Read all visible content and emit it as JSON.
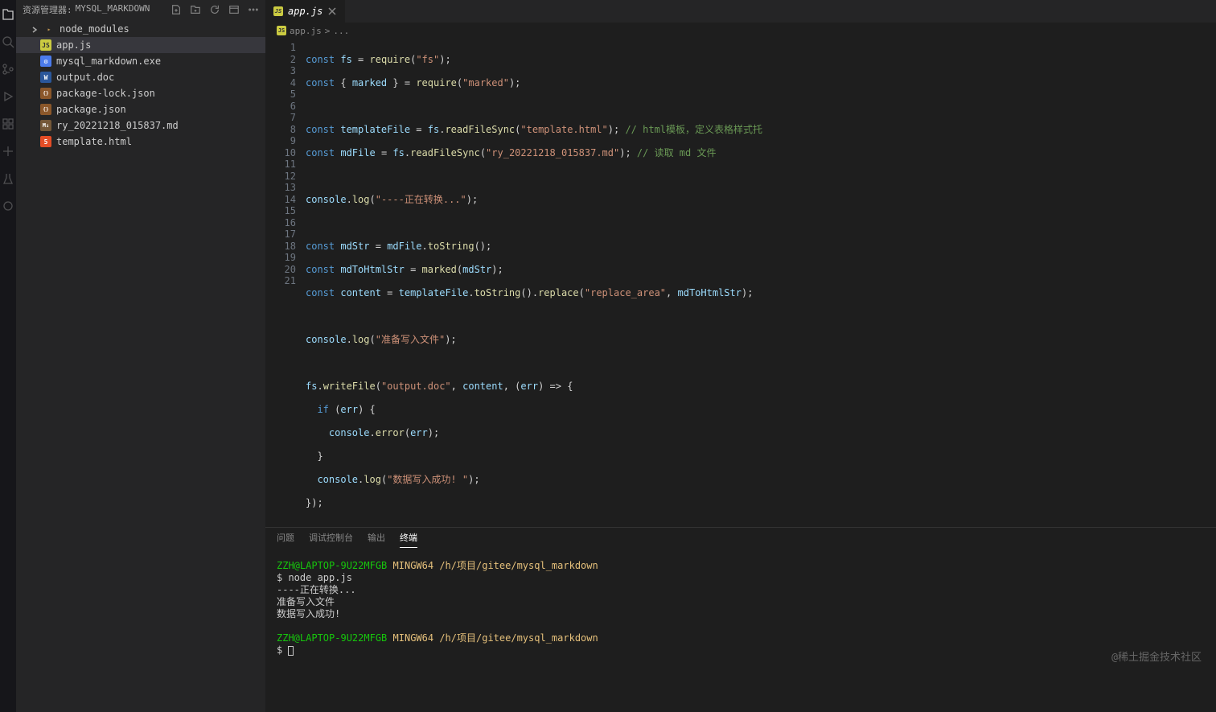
{
  "sidebar": {
    "title_label": "资源管理器:",
    "project": "MYSQL_MARKDOWN",
    "files": [
      {
        "name": "node_modules",
        "type": "folder"
      },
      {
        "name": "app.js",
        "type": "js",
        "active": true
      },
      {
        "name": "mysql_markdown.exe",
        "type": "exe"
      },
      {
        "name": "output.doc",
        "type": "doc"
      },
      {
        "name": "package-lock.json",
        "type": "json"
      },
      {
        "name": "package.json",
        "type": "json"
      },
      {
        "name": "ry_20221218_015837.md",
        "type": "md"
      },
      {
        "name": "template.html",
        "type": "html"
      }
    ]
  },
  "tab": {
    "name": "app.js"
  },
  "breadcrumb": {
    "file": "app.js",
    "sep": ">",
    "rest": "..."
  },
  "gutter_lines": [
    "1",
    "2",
    "3",
    "4",
    "5",
    "6",
    "7",
    "8",
    "9",
    "10",
    "11",
    "12",
    "13",
    "14",
    "15",
    "16",
    "17",
    "18",
    "19",
    "20",
    "21"
  ],
  "panel": {
    "tabs": [
      "问题",
      "调试控制台",
      "输出",
      "终端"
    ],
    "active": 3,
    "term": {
      "host": "ZZH@LAPTOP-9U22MFGB",
      "shell": "MINGW64",
      "path": "/h/项目/gitee/mysql_markdown",
      "cmd": "node  app.js",
      "out1": "----正在转换...",
      "out2": "准备写入文件",
      "out3": "数据写入成功!"
    }
  },
  "watermark": "@稀土掘金技术社区",
  "code": {
    "l1": {
      "a": "const",
      "b": "fs",
      "c": "=",
      "d": "require",
      "e": "(",
      "f": "\"fs\"",
      "g": ");"
    },
    "l2": {
      "a": "const",
      "b": "{ ",
      "c": "marked",
      "d": " }",
      "e": "=",
      "f": "require",
      "g": "(",
      "h": "\"marked\"",
      "i": ");"
    },
    "l4": {
      "a": "const",
      "b": "templateFile",
      "c": "=",
      "d": "fs",
      "e": ".",
      "f": "readFileSync",
      "g": "(",
      "h": "\"template.html\"",
      "i": ");",
      "j": "// html模板，定义表格样式托"
    },
    "l5": {
      "a": "const",
      "b": "mdFile",
      "c": "=",
      "d": "fs",
      "e": ".",
      "f": "readFileSync",
      "g": "(",
      "h": "\"ry_20221218_015837.md\"",
      "i": ");",
      "j": "// 读取 md 文件"
    },
    "l7": {
      "a": "console",
      "b": ".",
      "c": "log",
      "d": "(",
      "e": "\"----正在转换...\"",
      "f": ");"
    },
    "l9": {
      "a": "const",
      "b": "mdStr",
      "c": "=",
      "d": "mdFile",
      "e": ".",
      "f": "toString",
      "g": "();"
    },
    "l10": {
      "a": "const",
      "b": "mdToHtmlStr",
      "c": "=",
      "d": "marked",
      "e": "(",
      "f": "mdStr",
      "g": ");"
    },
    "l11": {
      "a": "const",
      "b": "content",
      "c": "=",
      "d": "templateFile",
      "e": ".",
      "f": "toString",
      "g": "().",
      "h": "replace",
      "i": "(",
      "j": "\"replace_area\"",
      "k": ",",
      "l": "mdToHtmlStr",
      "m": ");"
    },
    "l13": {
      "a": "console",
      "b": ".",
      "c": "log",
      "d": "(",
      "e": "\"准备写入文件\"",
      "f": ");"
    },
    "l15": {
      "a": "fs",
      "b": ".",
      "c": "writeFile",
      "d": "(",
      "e": "\"output.doc\"",
      "f": ",",
      "g": "content",
      "h": ", (",
      "i": "err",
      "j": ") => {"
    },
    "l16": {
      "a": "if",
      "b": "(",
      "c": "err",
      "d": ") {"
    },
    "l17": {
      "a": "console",
      "b": ".",
      "c": "error",
      "d": "(",
      "e": "err",
      "f": ");"
    },
    "l18": {
      "a": "}"
    },
    "l19": {
      "a": "console",
      "b": ".",
      "c": "log",
      "d": "(",
      "e": "\"数据写入成功! \"",
      "f": ");"
    },
    "l20": {
      "a": "});"
    }
  }
}
